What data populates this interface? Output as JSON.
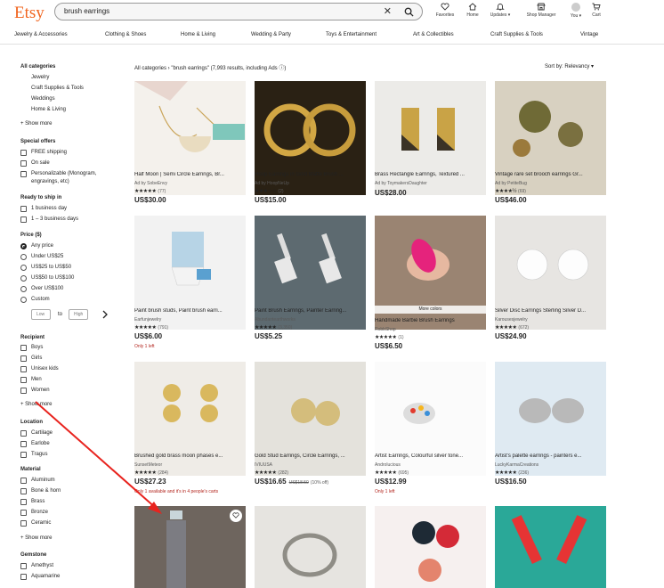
{
  "header": {
    "logo": "Etsy",
    "search_value": "brush earrings",
    "nav": [
      {
        "label": "Favorites",
        "icon": "heart-icon"
      },
      {
        "label": "Home",
        "icon": "home-icon"
      },
      {
        "label": "Updates ▾",
        "icon": "bell-icon"
      },
      {
        "label": "Shop Manager",
        "icon": "shop-icon"
      },
      {
        "label": "You ▾",
        "icon": "avatar-icon"
      },
      {
        "label": "Cart",
        "icon": "cart-icon"
      }
    ]
  },
  "categories": [
    "Jewelry & Accessories",
    "Clothing & Shoes",
    "Home & Living",
    "Wedding & Party",
    "Toys & Entertainment",
    "Art & Collectibles",
    "Craft Supplies & Tools",
    "Vintage"
  ],
  "sidebar": {
    "all_categories": "All categories",
    "cat_items": [
      "Jewelry",
      "Craft Supplies & Tools",
      "Weddings",
      "Home & Living"
    ],
    "show_more": "Show more",
    "special_offers": {
      "title": "Special offers",
      "items": [
        "FREE shipping",
        "On sale",
        "Personalizable (Monogram,",
        "engravings, etc)"
      ]
    },
    "ready": {
      "title": "Ready to ship in",
      "items": [
        "1 business day",
        "1 – 3 business days"
      ]
    },
    "price": {
      "title": "Price ($)",
      "items": [
        "Any price",
        "Under US$25",
        "US$25 to US$50",
        "US$50 to US$100",
        "Over US$100",
        "Custom"
      ],
      "low": "Low",
      "to": "to",
      "high": "High"
    },
    "recipient": {
      "title": "Recipient",
      "items": [
        "Boys",
        "Girls",
        "Unisex kids",
        "Men",
        "Women"
      ]
    },
    "location": {
      "title": "Location",
      "items": [
        "Cartilage",
        "Earlobe",
        "Tragus"
      ]
    },
    "material": {
      "title": "Material",
      "items": [
        "Aluminum",
        "Bone & horn",
        "Brass",
        "Bronze",
        "Ceramic"
      ]
    },
    "gemstone": {
      "title": "Gemstone",
      "items": [
        "Amethyst",
        "Aquamarine"
      ]
    }
  },
  "results": {
    "breadcrumb": "All categories › \"brush earrings\" (7,993 results, including Ads ⓘ)",
    "sort": "Sort by: Relevancy ▾",
    "more_colors": "More colors",
    "cards": [
      {
        "title": "Half Moon | Semi Circle Earrings, Br...",
        "shop": "Ad by SobeEnvy",
        "stars": "★★★★★",
        "count": "(77)",
        "price": "US$30.00",
        "orig": "",
        "disc": "",
        "note": ""
      },
      {
        "title": "Hoop Earrings in Gold Matte Brush ...",
        "shop": "Ad by HoopNeUp",
        "stars": "★★★☆☆",
        "count": "(2)",
        "price": "US$15.00",
        "orig": "",
        "disc": "",
        "note": ""
      },
      {
        "title": "Brass Rectangle Earrings, Textured ...",
        "shop": "Ad by ToymakersDaughter",
        "stars": "",
        "count": "",
        "price": "US$28.00",
        "orig": "",
        "disc": "",
        "note": ""
      },
      {
        "title": "Vintage rare set brooch earrings Gr...",
        "shop": "Ad by PetiteBug",
        "stars": "★★★★½",
        "count": "(69)",
        "price": "US$46.00",
        "orig": "",
        "disc": "",
        "note": ""
      },
      {
        "title": "Paint brush studs, Paint brush earri...",
        "shop": "Earfunjewelry",
        "stars": "★★★★★",
        "count": "(791)",
        "price": "US$6.00",
        "orig": "",
        "disc": "",
        "note": "Only 1 left"
      },
      {
        "title": "Paint Brush Earrings, Painter Earring...",
        "shop": "Abundantearthworks",
        "stars": "★★★★★",
        "count": "(3,350)",
        "price": "US$5.25",
        "orig": "",
        "disc": "",
        "note": ""
      },
      {
        "title": "Handmade Barbie Brush Earrings",
        "shop": "RobbShop",
        "stars": "★★★★★",
        "count": "(1)",
        "price": "US$6.50",
        "orig": "",
        "disc": "",
        "note": ""
      },
      {
        "title": "Silver Disc Earrings Sterling Silver D...",
        "shop": "Karousesjewelry",
        "stars": "★★★★★",
        "count": "(672)",
        "price": "US$24.90",
        "orig": "",
        "disc": "",
        "note": ""
      },
      {
        "title": "Brushed gold brass moon phases e...",
        "shop": "SunsetMeteor",
        "stars": "★★★★★",
        "count": "(284)",
        "price": "US$27.23",
        "orig": "",
        "disc": "",
        "note": "Only 1 available and it's in 4 people's carts"
      },
      {
        "title": "Gold Stud Earrings, Circle Earrings, ...",
        "shop": "IVIUUSA",
        "stars": "★★★★★",
        "count": "(282)",
        "price": "US$16.65",
        "orig": "US$18.50",
        "disc": "(10% off)",
        "note": ""
      },
      {
        "title": "Artist Earrings, Colourful silver tone...",
        "shop": "Androlucious",
        "stars": "★★★★★",
        "count": "(695)",
        "price": "US$12.99",
        "orig": "",
        "disc": "",
        "note": "Only 1 left"
      },
      {
        "title": "Artist's palette earrings - painters e...",
        "shop": "LuckyKarmaCreations",
        "stars": "★★★★★",
        "count": "(236)",
        "price": "US$16.50",
        "orig": "",
        "disc": "",
        "note": ""
      }
    ]
  },
  "colors": {
    "accent": "#f1641e",
    "annotation": "#e8231e",
    "sale": "#b3261e"
  }
}
